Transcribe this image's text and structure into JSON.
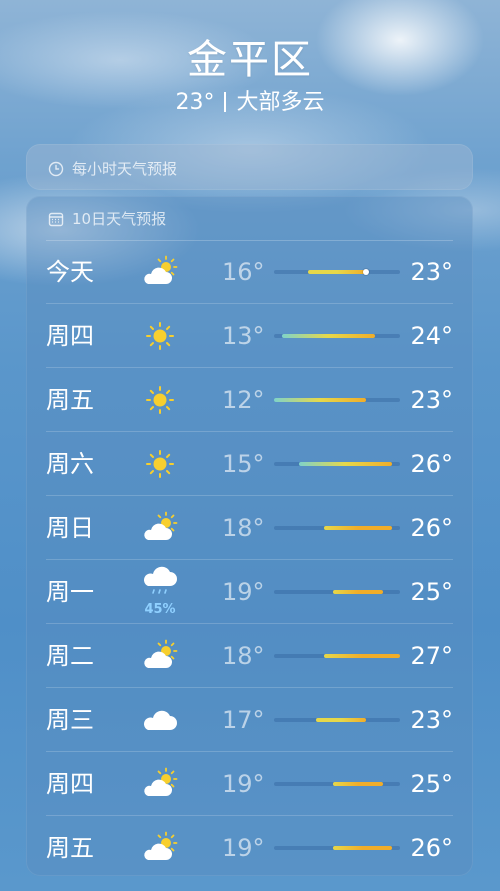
{
  "location": {
    "city": "金平区",
    "temperature": "23°",
    "condition": "大部多云"
  },
  "hourly_card": {
    "title": "每小时天气预报",
    "icon": "clock-icon"
  },
  "daily_card": {
    "title": "10日天气预报",
    "icon": "calendar-icon",
    "range_min": 12,
    "range_max": 27,
    "current_temp": 23,
    "days": [
      {
        "day": "今天",
        "icon": "partly-sunny-icon",
        "low": "16°",
        "high": "23°",
        "low_val": 16,
        "high_val": 23,
        "precip": ""
      },
      {
        "day": "周四",
        "icon": "sun-icon",
        "low": "13°",
        "high": "24°",
        "low_val": 13,
        "high_val": 24,
        "precip": ""
      },
      {
        "day": "周五",
        "icon": "sun-icon",
        "low": "12°",
        "high": "23°",
        "low_val": 12,
        "high_val": 23,
        "precip": ""
      },
      {
        "day": "周六",
        "icon": "sun-icon",
        "low": "15°",
        "high": "26°",
        "low_val": 15,
        "high_val": 26,
        "precip": ""
      },
      {
        "day": "周日",
        "icon": "partly-sunny-icon",
        "low": "18°",
        "high": "26°",
        "low_val": 18,
        "high_val": 26,
        "precip": ""
      },
      {
        "day": "周一",
        "icon": "rain-cloud-icon",
        "low": "19°",
        "high": "25°",
        "low_val": 19,
        "high_val": 25,
        "precip": "45%"
      },
      {
        "day": "周二",
        "icon": "partly-sunny-icon",
        "low": "18°",
        "high": "27°",
        "low_val": 18,
        "high_val": 27,
        "precip": ""
      },
      {
        "day": "周三",
        "icon": "cloud-icon",
        "low": "17°",
        "high": "23°",
        "low_val": 17,
        "high_val": 23,
        "precip": ""
      },
      {
        "day": "周四",
        "icon": "partly-sunny-icon",
        "low": "19°",
        "high": "25°",
        "low_val": 19,
        "high_val": 25,
        "precip": ""
      },
      {
        "day": "周五",
        "icon": "partly-sunny-icon",
        "low": "19°",
        "high": "26°",
        "low_val": 19,
        "high_val": 26,
        "precip": ""
      }
    ]
  },
  "colors": {
    "cool": "#7fd3c9",
    "mild": "#e6d84a",
    "warm": "#f0ad2a"
  }
}
